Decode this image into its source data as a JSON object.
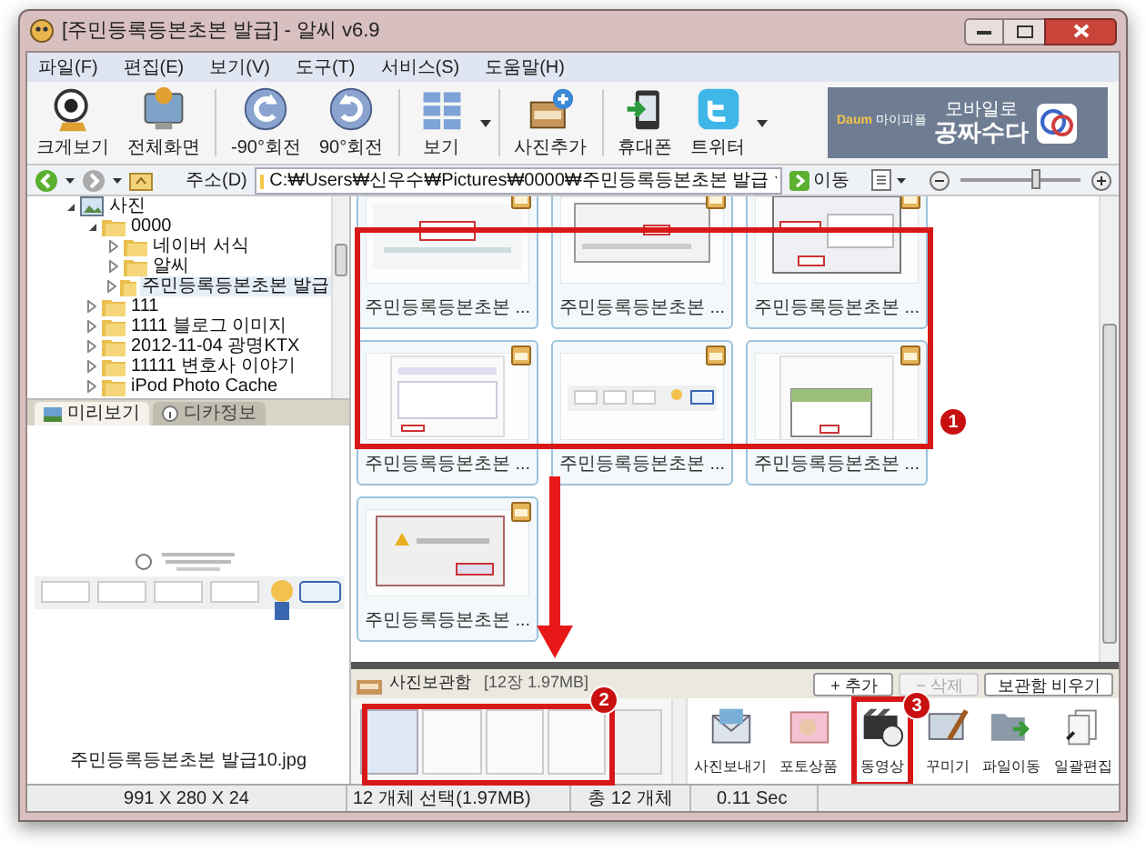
{
  "window": {
    "title": "[주민등록등본초본 발급] - 알씨 v6.9"
  },
  "menu": [
    "파일(F)",
    "편집(E)",
    "보기(V)",
    "도구(T)",
    "서비스(S)",
    "도움말(H)"
  ],
  "toolbar": [
    {
      "kind": "zoom",
      "label": "크게보기",
      "dropdown": false
    },
    {
      "kind": "fullscreen",
      "label": "전체화면",
      "dropdown": false
    },
    {
      "kind": "rotate-left",
      "label": "-90°회전",
      "dropdown": false
    },
    {
      "kind": "rotate-right",
      "label": "90°회전",
      "dropdown": false
    },
    {
      "kind": "view",
      "label": "보기",
      "dropdown": true
    },
    {
      "kind": "add-photo",
      "label": "사진추가",
      "dropdown": false
    },
    {
      "kind": "phone",
      "label": "휴대폰",
      "dropdown": false
    },
    {
      "kind": "twitter",
      "label": "트위터",
      "dropdown": true
    }
  ],
  "banner": {
    "brand": "Daum",
    "service": "마이피플",
    "line1": "모바일로",
    "line2": "공짜수다"
  },
  "zoom_slider": {
    "level": 0.62
  },
  "address": {
    "label": "주소(D)",
    "path": "C:₩Users₩신우수₩Pictures₩0000₩주민등록등본초본 발급",
    "go": "이동"
  },
  "tree": [
    {
      "label": "사진",
      "expanded": true,
      "selected": false,
      "children": [
        {
          "label": "0000",
          "expanded": true,
          "selected": false,
          "children": [
            {
              "label": "네이버 서식",
              "expanded": false,
              "selected": false
            },
            {
              "label": "알씨",
              "expanded": false,
              "selected": false
            },
            {
              "label": "주민등록등본초본 발급",
              "expanded": false,
              "selected": true
            }
          ]
        },
        {
          "label": "111",
          "expanded": false,
          "selected": false
        },
        {
          "label": "1111 블로그 이미지",
          "expanded": false,
          "selected": false
        },
        {
          "label": "2012-11-04 광명KTX",
          "expanded": false,
          "selected": false
        },
        {
          "label": "11111 변호사 이야기",
          "expanded": false,
          "selected": false
        },
        {
          "label": "iPod Photo Cache",
          "expanded": false,
          "selected": false
        }
      ]
    }
  ],
  "info_tabs": [
    {
      "label": "미리보기",
      "selected": true
    },
    {
      "label": "디카정보",
      "selected": false
    }
  ],
  "preview": {
    "filename": "주민등록등본초본 발급10.jpg"
  },
  "thumbnails": [
    {
      "caption": "주민등록등본초본 ...",
      "selected": true
    },
    {
      "caption": "주민등록등본초본 ...",
      "selected": true
    },
    {
      "caption": "주민등록등본초본 ...",
      "selected": true
    },
    {
      "caption": "주민등록등본초본 ...",
      "selected": true
    },
    {
      "caption": "주민등록등본초본 ...",
      "selected": true
    },
    {
      "caption": "주민등록등본초본 ...",
      "selected": true
    },
    {
      "caption": "주민등록등본초본 ...",
      "selected": true
    }
  ],
  "tray": {
    "title": "사진보관함",
    "count": "[12장 1.97MB]",
    "buttons": [
      {
        "label": "+ 추가",
        "disabled": false
      },
      {
        "label": "− 삭제",
        "disabled": true
      },
      {
        "label": "보관함 비우기",
        "disabled": false
      }
    ],
    "actions": [
      "사진보내기",
      "포토상품",
      "동영상",
      "꾸미기",
      "파일이동",
      "일괄편집"
    ]
  },
  "status_bar": [
    "991 X 280 X 24",
    "12 개체 선택(1.97MB)",
    "총 12 개체",
    "0.11 Sec"
  ],
  "annotations": [
    {
      "label": "1"
    },
    {
      "label": "2"
    },
    {
      "label": "3"
    }
  ]
}
